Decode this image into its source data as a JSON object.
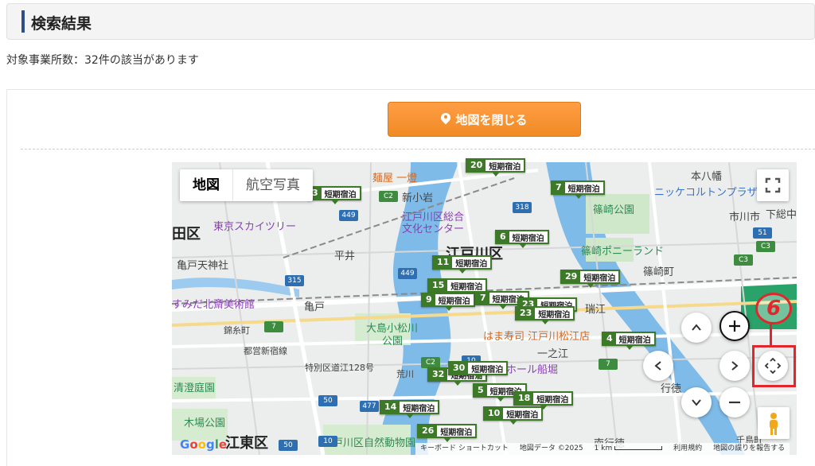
{
  "header": {
    "title": "検索結果"
  },
  "result_count_text": "対象事業所数：32件の該当があります",
  "close_map_button": {
    "label": "地図を閉じる"
  },
  "map": {
    "type_tabs": [
      "地図",
      "航空写真"
    ],
    "marker_label": "短期宿泊",
    "markers": [
      {
        "num": "20"
      },
      {
        "num": "7"
      },
      {
        "num": "3"
      },
      {
        "num": "6"
      },
      {
        "num": "11"
      },
      {
        "num": "29"
      },
      {
        "num": "15"
      },
      {
        "num": "9"
      },
      {
        "num": "7"
      },
      {
        "num": "23"
      },
      {
        "num": "23"
      },
      {
        "num": "4"
      },
      {
        "num": "32"
      },
      {
        "num": "5"
      },
      {
        "num": "18"
      },
      {
        "num": "14"
      },
      {
        "num": "10"
      },
      {
        "num": "26"
      },
      {
        "num": "30"
      }
    ],
    "labels": {
      "edogawa": "江戸川区",
      "koto": "江東区",
      "sumida_edge": "田区",
      "sky_tree": "東京スカイツリー",
      "kameido_tenjin": "亀戸天神社",
      "hokusai": "すみだ北斎美術館",
      "kameido": "亀戸",
      "hirai": "平井",
      "ojima": "大島小松川",
      "ojima2": "公園",
      "toei_shinjuku": "都営新宿線",
      "tokubetsu": "特別区道江128号",
      "kiyosumi": "清澄庭園",
      "kiba": "木場公園",
      "shizen": "江戸川区自然動物園",
      "menya": "麺屋 一燈",
      "shinkoiwa": "新小岩",
      "culture1": "江戸川区総合",
      "culture2": "文化センター",
      "hamazushi": "はま寿司 江戸川松江店",
      "funabori": "ホール船堀",
      "shinozaki_park": "篠崎公園",
      "shinozaki_pony": "篠崎ポニーランド",
      "shinozaki": "篠崎町",
      "mizue": "瑞江",
      "ichinoe": "一之江",
      "gyotoku": "行徳",
      "minamigyotoku": "南行徳",
      "motoyawata": "本八幡",
      "nitori": "ニッケコルトンプラザ",
      "ichikawa": "市川市",
      "shimousa": "下総中",
      "chidori": "千鳥町",
      "kinshicho": "錦糸町",
      "arakawa": "荒川"
    },
    "shields": [
      "449",
      "318",
      "449",
      "315",
      "7",
      "50",
      "10",
      "7",
      "C2",
      "C2",
      "477",
      "10",
      "50",
      "C3",
      "51",
      "C3"
    ],
    "attribution": [
      "キーボード ショートカット",
      "地図データ ©2025",
      "1 km",
      "利用規約",
      "地図の誤りを報告する"
    ],
    "google": "Google"
  },
  "annotation": {
    "badge": "6"
  }
}
